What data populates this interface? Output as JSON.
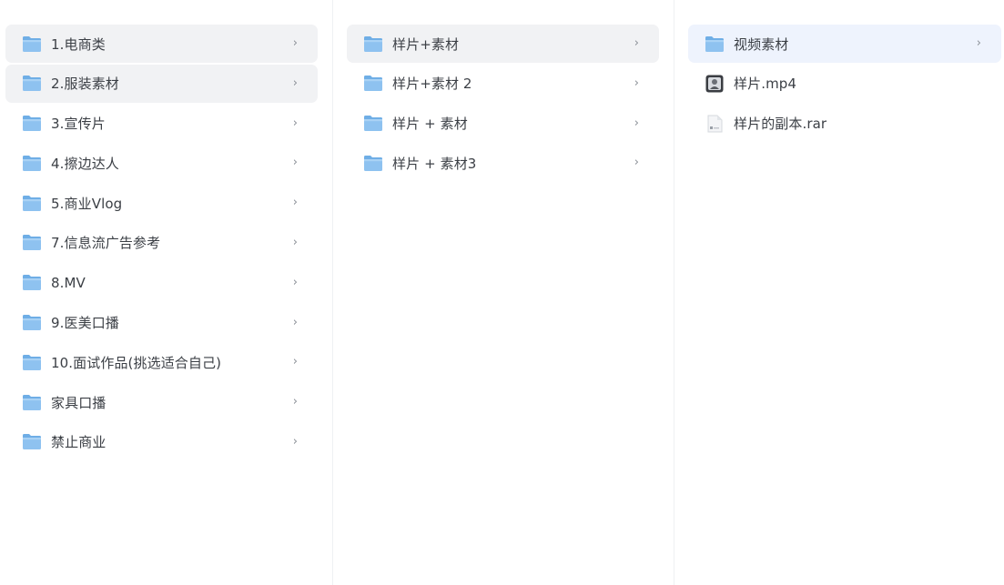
{
  "columns": [
    {
      "items": [
        {
          "label": "1.电商类",
          "type": "folder",
          "state": "selected"
        },
        {
          "label": "2.服装素材",
          "type": "folder",
          "state": "selected"
        },
        {
          "label": "3.宣传片",
          "type": "folder",
          "state": ""
        },
        {
          "label": "4.擦边达人",
          "type": "folder",
          "state": ""
        },
        {
          "label": "5.商业Vlog",
          "type": "folder",
          "state": ""
        },
        {
          "label": "7.信息流广告参考",
          "type": "folder",
          "state": ""
        },
        {
          "label": "8.MV",
          "type": "folder",
          "state": ""
        },
        {
          "label": "9.医美口播",
          "type": "folder",
          "state": ""
        },
        {
          "label": "10.面试作品(挑选适合自己)",
          "type": "folder",
          "state": ""
        },
        {
          "label": "家具口播",
          "type": "folder",
          "state": ""
        },
        {
          "label": "禁止商业",
          "type": "folder",
          "state": ""
        }
      ]
    },
    {
      "items": [
        {
          "label": "样片+素材",
          "type": "folder",
          "state": "selected"
        },
        {
          "label": "样片+素材 2",
          "type": "folder",
          "state": ""
        },
        {
          "label": "样片 + 素材",
          "type": "folder",
          "state": ""
        },
        {
          "label": "样片 + 素材3",
          "type": "folder",
          "state": ""
        }
      ]
    },
    {
      "items": [
        {
          "label": "视频素材",
          "type": "folder",
          "state": "active"
        },
        {
          "label": "样片.mp4",
          "type": "video",
          "state": ""
        },
        {
          "label": "样片的副本.rar",
          "type": "archive",
          "state": ""
        }
      ]
    }
  ],
  "chevron_glyph": "›",
  "colors": {
    "folder_fill": "#8ec2f0",
    "selected_bg": "#f1f2f4",
    "active_bg": "#eef3fd",
    "text": "#3b3f45"
  }
}
